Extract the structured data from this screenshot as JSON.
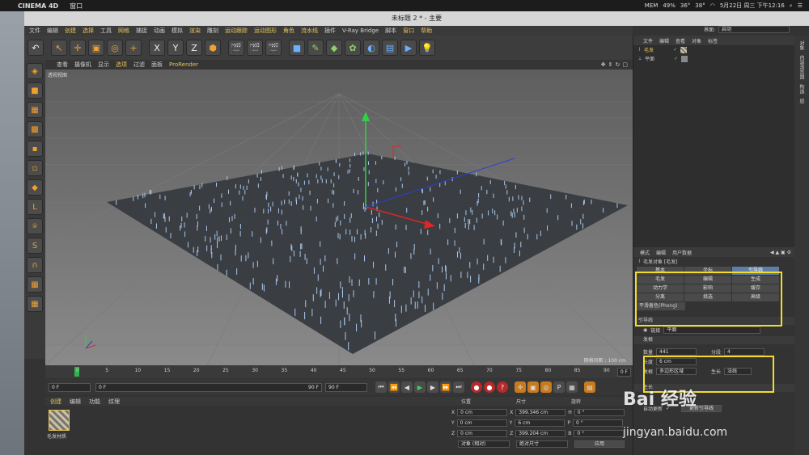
{
  "mac": {
    "app": "CINEMA 4D",
    "menu1": "窗口",
    "mem_label": "MEM",
    "mem_pct": "49%",
    "cpu1": "36°",
    "cpu2": "38°",
    "date": "5月22日 周三 下午12:16"
  },
  "window": {
    "title": "未标题 2 * - 主要"
  },
  "menubar": {
    "items": [
      "文件",
      "编辑",
      "创建",
      "选择",
      "工具",
      "网格",
      "捕捉",
      "动画",
      "模拟",
      "渲染",
      "雕刻",
      "运动跟踪",
      "运动图形",
      "角色",
      "流水线",
      "插件",
      "V-Ray Bridge",
      "脚本",
      "窗口",
      "帮助"
    ],
    "layout_label": "界面:",
    "layout_value": "启动"
  },
  "toolbar": {
    "x": "X",
    "y": "Y",
    "z": "Z"
  },
  "viewport": {
    "menu": [
      "查看",
      "摄像机",
      "显示",
      "选项",
      "过滤",
      "面板",
      "ProRender"
    ],
    "label": "透视视图",
    "grid": "网格间距 : 100 cm"
  },
  "timeline": {
    "ticks": [
      "0",
      "5",
      "10",
      "15",
      "20",
      "25",
      "30",
      "35",
      "40",
      "45",
      "50",
      "55",
      "60",
      "65",
      "70",
      "75",
      "80",
      "85",
      "90"
    ],
    "frame_end": "0 F"
  },
  "transport": {
    "cur": "0 F",
    "start": "0 F",
    "range": "90 F",
    "end": "90 F"
  },
  "materials": {
    "menu": [
      "创建",
      "编辑",
      "功能",
      "纹理"
    ],
    "mat_name": "毛发材质"
  },
  "coords": {
    "headers": [
      "位置",
      "尺寸",
      "旋转"
    ],
    "rows": [
      {
        "a": "X",
        "pos": "0 cm",
        "b": "X",
        "size": "399.346 cm",
        "c": "H",
        "rot": "0 °"
      },
      {
        "a": "Y",
        "pos": "0 cm",
        "b": "Y",
        "size": "6 cm",
        "c": "P",
        "rot": "0 °"
      },
      {
        "a": "Z",
        "pos": "0 cm",
        "b": "Z",
        "size": "399.204 cm",
        "c": "B",
        "rot": "0 °"
      }
    ],
    "mode": "对象 (相对)",
    "size_mode": "绝对尺寸",
    "apply": "应用"
  },
  "objects": {
    "menu": [
      "文件",
      "编辑",
      "查看",
      "对象",
      "标签"
    ],
    "items": [
      "毛发",
      "平面"
    ]
  },
  "attributes": {
    "menu": [
      "模式",
      "编辑",
      "用户数据"
    ],
    "object": "毛发对象 [毛发]",
    "tabs": [
      [
        "基本",
        "坐标",
        "引导线"
      ],
      [
        "毛发",
        "编辑",
        "生成"
      ],
      [
        "动力学",
        "影响",
        "缓存"
      ],
      [
        "分离",
        "挑选",
        "高级"
      ]
    ],
    "phong": "平滑着色(Phong)",
    "section": "引导线",
    "link_label": "链接",
    "link_value": "平面",
    "sub": "发根",
    "count_label": "数量",
    "count": "441",
    "seg_label": "分段",
    "seg": "4",
    "len_label": "长度",
    "len": "6 cm",
    "root_label": "发根",
    "root": "多边形区域",
    "growth_label": "生长",
    "growth": "法线",
    "grow_section": "生长",
    "auto": "自动更新",
    "update_btn": "更新引导线"
  },
  "side_tabs": [
    "对象",
    "内容浏览器",
    "构造",
    "层"
  ],
  "watermark": {
    "t1": "Bai 经验",
    "t2": "jingyan.baidu.com"
  }
}
